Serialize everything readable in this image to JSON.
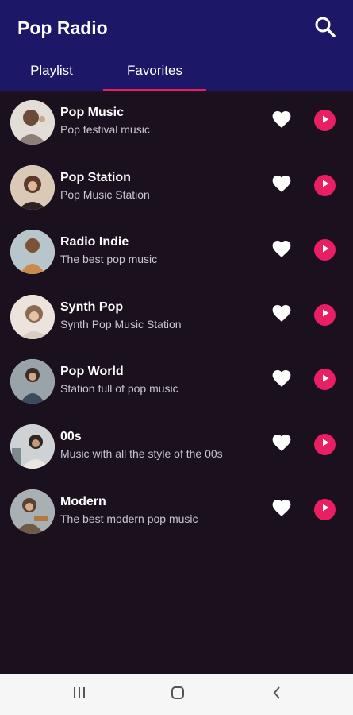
{
  "app": {
    "title": "Pop Radio",
    "search_icon": "search-icon"
  },
  "tabs": [
    {
      "label": "Playlist",
      "selected": false
    },
    {
      "label": "Favorites",
      "selected": true
    }
  ],
  "colors": {
    "header_bg": "#1d1768",
    "body_bg": "#1b111e",
    "accent": "#e91e63",
    "tab_indicator": "#e9205f"
  },
  "stations": [
    {
      "name": "Pop Music",
      "description": "Pop festival music",
      "favorite": true,
      "play_icon": "play-icon"
    },
    {
      "name": "Pop Station",
      "description": "Pop Music Station",
      "favorite": true,
      "play_icon": "play-icon"
    },
    {
      "name": "Radio Indie",
      "description": "The best pop music",
      "favorite": true,
      "play_icon": "play-icon"
    },
    {
      "name": "Synth Pop",
      "description": "Synth Pop Music Station",
      "favorite": true,
      "play_icon": "play-icon"
    },
    {
      "name": "Pop World",
      "description": "Station full of pop music",
      "favorite": true,
      "play_icon": "play-icon"
    },
    {
      "name": "00s",
      "description": "Music with all the style of the 00s",
      "favorite": true,
      "play_icon": "play-icon"
    },
    {
      "name": "Modern",
      "description": "The best modern pop music",
      "favorite": true,
      "play_icon": "play-icon"
    }
  ],
  "system_nav": {
    "recents_icon": "recents-icon",
    "home_icon": "home-icon",
    "back_icon": "back-icon"
  }
}
